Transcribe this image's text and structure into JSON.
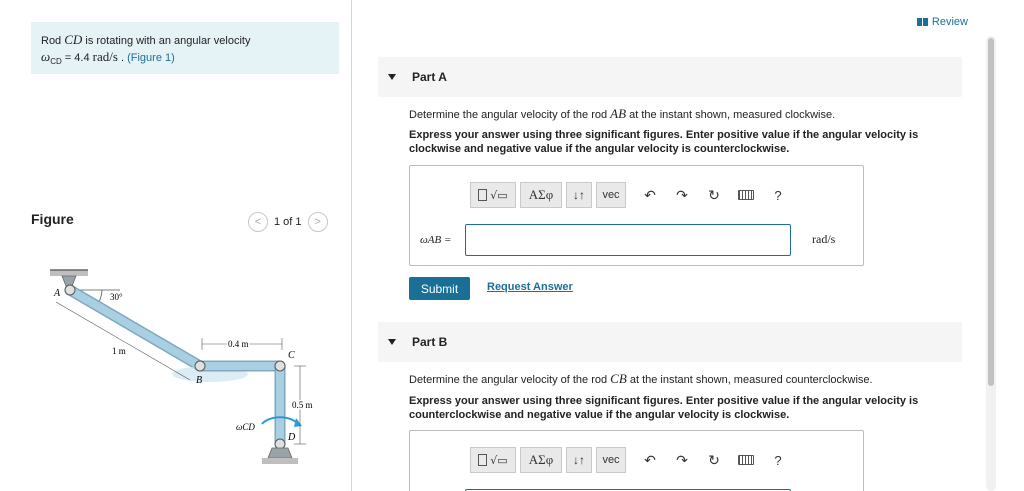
{
  "problem": {
    "intro": "Rod ",
    "rod": "CD",
    "mid": " is rotating with an angular velocity",
    "omega": "ω",
    "omega_sub": "CD",
    "equals": " = 4.4 ",
    "unit": "rad/s",
    "period": " . ",
    "figure_link": "(Figure 1)"
  },
  "figure": {
    "title": "Figure",
    "pager": "1 of 1",
    "prev": "<",
    "next": ">",
    "labels": {
      "A": "A",
      "B": "B",
      "C": "C",
      "D": "D",
      "angle": "30°",
      "len_ab": "1 m",
      "len_bc": "0.4 m",
      "len_cd": "0.5 m",
      "omega_cd": "ωCD"
    }
  },
  "header": {
    "review": "Review"
  },
  "partA": {
    "title": "Part A",
    "q_pre": "Determine the angular velocity of the rod ",
    "q_rod": "AB",
    "q_post": " at the instant shown, measured clockwise.",
    "instruction": "Express your answer using three significant figures. Enter positive value if the angular velocity is clockwise and negative value if the angular velocity is counterclockwise.",
    "toolbar": {
      "greek": "ΑΣφ",
      "arrows": "↓↑",
      "vec": "vec",
      "help": "?"
    },
    "answer_label": "ωAB =",
    "answer_value": "",
    "answer_unit": "rad/s",
    "submit": "Submit",
    "request": "Request Answer"
  },
  "partB": {
    "title": "Part B",
    "q_pre": "Determine the angular velocity of the rod ",
    "q_rod": "CB",
    "q_post": " at the instant shown, measured counterclockwise.",
    "instruction": "Express your answer using three significant figures. Enter positive value if the angular velocity is counterclockwise and negative value if the angular velocity is clockwise.",
    "toolbar": {
      "greek": "ΑΣφ",
      "arrows": "↓↑",
      "vec": "vec",
      "help": "?"
    }
  },
  "colors": {
    "accent": "#1a6f96",
    "problem_bg": "#e5f3f7",
    "rod": "#a9cfe3"
  }
}
